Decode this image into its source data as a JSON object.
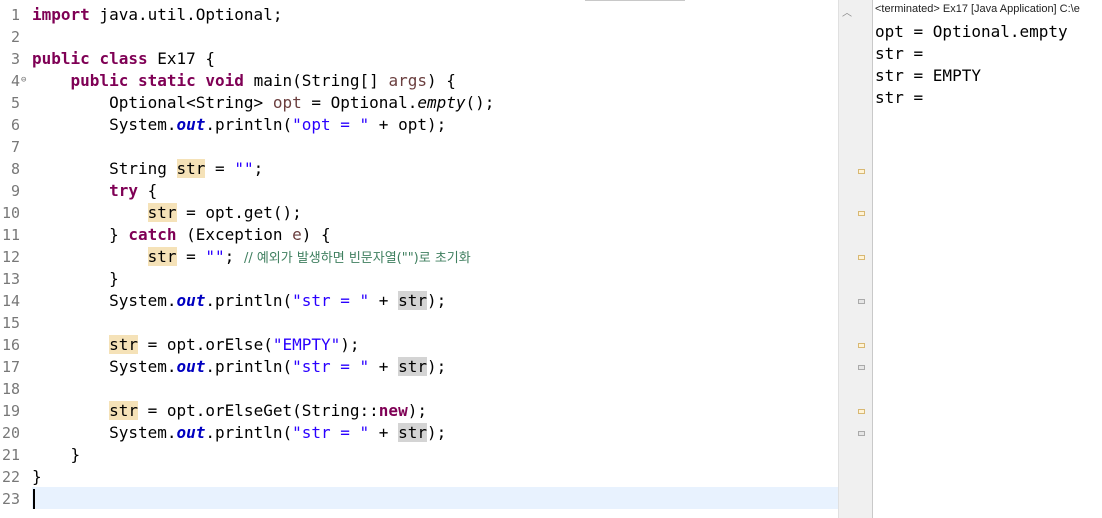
{
  "editor": {
    "line_numbers": [
      "1",
      "2",
      "3",
      "4",
      "5",
      "6",
      "7",
      "8",
      "9",
      "10",
      "11",
      "12",
      "13",
      "14",
      "15",
      "16",
      "17",
      "18",
      "19",
      "20",
      "21",
      "22",
      "23"
    ],
    "fold_marker_line": "4",
    "code": {
      "l1_kw": "import",
      "l1_rest": " java.util.Optional;",
      "l3_kw1": "public",
      "l3_kw2": "class",
      "l3_rest": " Ex17 {",
      "l4_indent": "    ",
      "l4_kw1": "public",
      "l4_kw2": "static",
      "l4_kw3": "void",
      "l4_a": " main(String[] ",
      "l4_param": "args",
      "l4_b": ") {",
      "l5_indent": "        ",
      "l5_a": "Optional<String> ",
      "l5_var": "opt",
      "l5_b": " = Optional.",
      "l5_method": "empty",
      "l5_c": "();",
      "print_a": "System.",
      "print_fld": "out",
      "print_b": ".println(",
      "l6_str": "\"opt = \"",
      "l6_rest": " + opt);",
      "l8_a": "String ",
      "l8_var": "str",
      "l8_b": " = ",
      "l8_str": "\"\"",
      "l8_c": ";",
      "l9_kw": "try",
      "l9_rest": " {",
      "l10_indent": "            ",
      "str_var": "str",
      "l10_rest": " = opt.get();",
      "l11_a": "} ",
      "l11_kw": "catch",
      "l11_b": " (Exception ",
      "l11_param": "e",
      "l11_c": ") {",
      "l12_a": " = ",
      "l12_str": "\"\"",
      "l12_b": "; ",
      "l12_cmt": "// 예외가 발생하면 빈문자열(\"\")로 초기화",
      "l13_text": "}",
      "print_str_lit": "\"str = \"",
      "plus": " + ",
      "close_paren": ");",
      "l16_a": " = opt.orElse(",
      "l16_str": "\"EMPTY\"",
      "l16_b": ");",
      "l19_a": " = opt.orElseGet(String::",
      "l19_kw": "new",
      "l19_b": ");",
      "l21_text": "}",
      "l22_text": "}"
    }
  },
  "console": {
    "header": "<terminated> Ex17 [Java Application] C:\\e",
    "output": [
      "opt = Optional.empty",
      "str = ",
      "str = EMPTY",
      "str = "
    ]
  },
  "colors": {
    "keyword": "#7f0055",
    "string": "#2a00ff",
    "field": "#0000c0",
    "comment": "#3f7f5f",
    "occurrence": "#f5e2b8",
    "current_line": "#e8f2fe"
  }
}
